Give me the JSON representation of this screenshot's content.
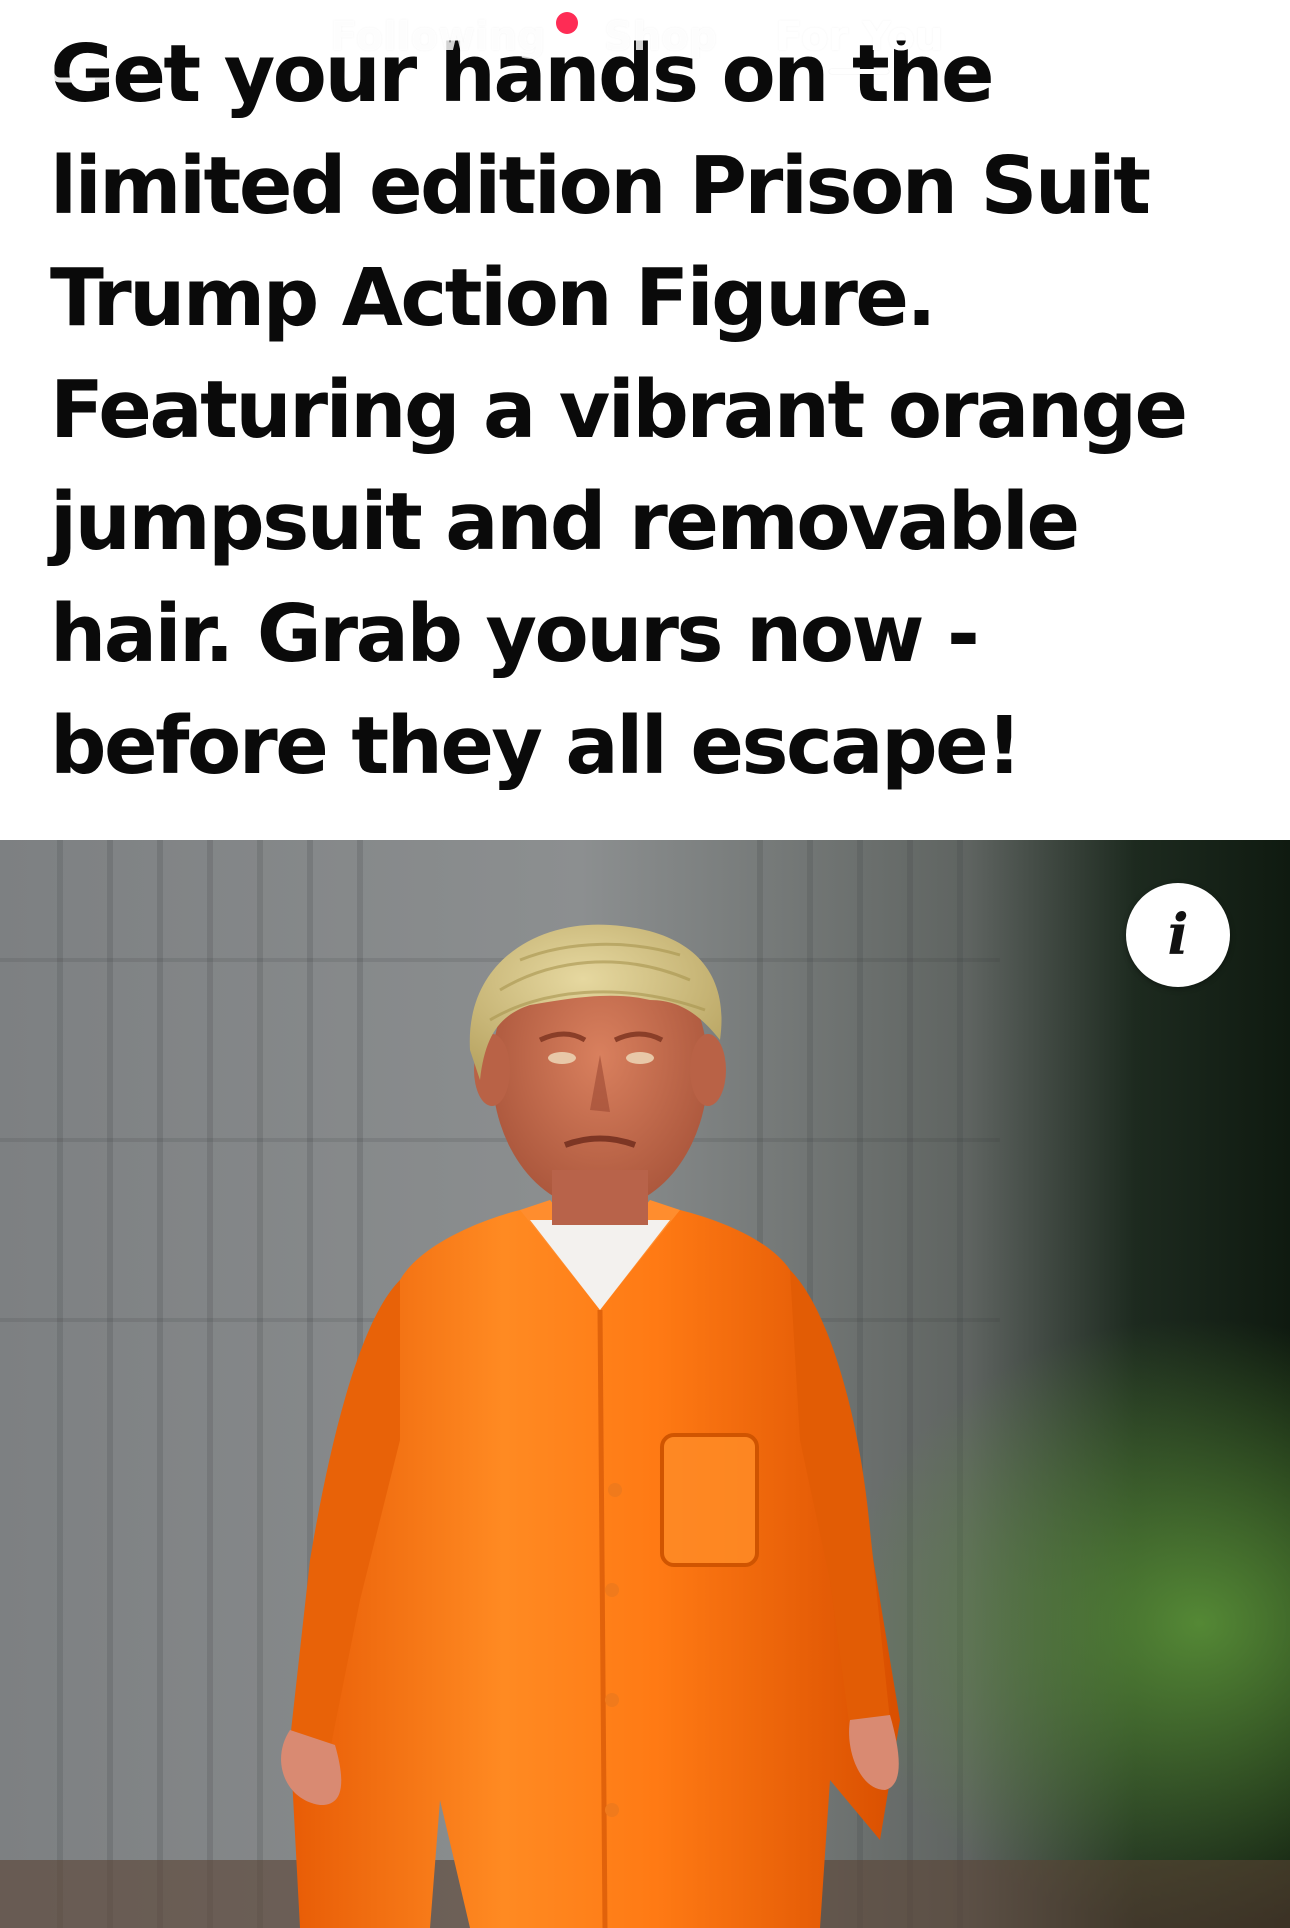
{
  "nav": {
    "tabs": [
      {
        "label": "Following",
        "active": false
      },
      {
        "label": "Shop",
        "active": false
      },
      {
        "label": "For You",
        "active": true
      }
    ],
    "live_icon": "live-tv-icon",
    "search_icon": "search-icon",
    "notification_dot_color": "#fe2c55"
  },
  "post": {
    "text": "Get your hands on the\nlimited edition Prison Suit\nTrump Action Figure.\nFeaturing a vibrant orange\njumpsuit and removable\nhair. Grab yours now -\nbefore they all escape!"
  },
  "image": {
    "info_label": "i",
    "info_icon": "info-icon",
    "jumpsuit_color": "#ff7a14"
  }
}
